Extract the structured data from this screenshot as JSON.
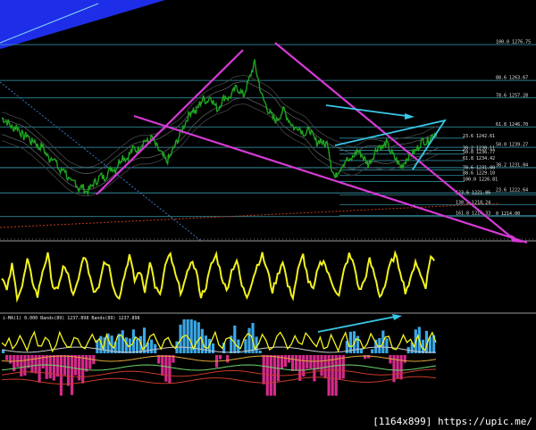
{
  "chart_data": [
    {
      "type": "line",
      "fib_left": {
        "levels": [
          "100.0",
          "88.6",
          "78.6",
          "61.8",
          "50.0",
          "38.2",
          "23.6",
          "0"
        ],
        "prices": [
          "1276.75",
          "1263.67",
          "1257.28",
          "1246.70",
          "1239.27",
          "1231.84",
          "1222.64",
          "1214.00"
        ]
      },
      "fib_mid": {
        "levels": [
          "23.6",
          "38.2",
          "50.0",
          "61.8",
          "78.6",
          "88.6",
          "100.0"
        ],
        "prices": [
          "1242.61",
          "1238.11",
          "1236.77",
          "1234.42",
          "1231.00",
          "1229.10",
          "1226.81"
        ]
      },
      "fib_lower": {
        "levels": [
          "123.6",
          "138.2",
          "161.8"
        ],
        "prices": [
          "1221.86",
          "1218.24",
          "1214.33"
        ]
      },
      "price_series": [
        1250,
        1249,
        1248,
        1246,
        1247,
        1245,
        1243,
        1244,
        1241,
        1242,
        1239,
        1240,
        1237,
        1235,
        1236,
        1233,
        1230,
        1232,
        1228,
        1226,
        1227,
        1224,
        1225,
        1223,
        1224,
        1226,
        1227,
        1229,
        1228,
        1230,
        1232,
        1231,
        1234,
        1236,
        1235,
        1237,
        1239,
        1238,
        1240,
        1242,
        1241,
        1243,
        1240,
        1238,
        1236,
        1234,
        1236,
        1239,
        1242,
        1245,
        1248,
        1251,
        1253,
        1252,
        1255,
        1257,
        1256,
        1258,
        1255,
        1253,
        1256,
        1258,
        1257,
        1259,
        1261,
        1260,
        1258,
        1262,
        1266,
        1270,
        1264,
        1258,
        1255,
        1252,
        1250,
        1249,
        1251,
        1253,
        1250,
        1248,
        1246,
        1247,
        1245,
        1244,
        1246,
        1243,
        1241,
        1242,
        1240,
        1241,
        1232,
        1228,
        1231,
        1233,
        1235,
        1234,
        1236,
        1238,
        1237,
        1235,
        1233,
        1235,
        1238,
        1240,
        1239,
        1241,
        1238,
        1236,
        1234,
        1232,
        1234,
        1236,
        1237,
        1238,
        1240,
        1242,
        1241,
        1243,
        1244,
        1245
      ],
      "oscillator": [
        0.5,
        0.2,
        0.7,
        0.1,
        0.3,
        0.8,
        0.4,
        0.1,
        0.6,
        0.9,
        0.3,
        0.2,
        0.7,
        0.5,
        0.1,
        0.4,
        0.9,
        0.6,
        0.2,
        0.3,
        0.8,
        0.7,
        0.2,
        0.1,
        0.5,
        0.9,
        0.4,
        0.6,
        0.2,
        0.8,
        0.3,
        0.1,
        0.7,
        0.9,
        0.5,
        0.2,
        0.4,
        0.8,
        0.6,
        0.1,
        0.3,
        0.7,
        0.9,
        0.5,
        0.2,
        0.6,
        0.8,
        0.3,
        0.1,
        0.4,
        0.7,
        0.9,
        0.6,
        0.2,
        0.5,
        0.8,
        0.3,
        0.1,
        0.6,
        0.9,
        0.4,
        0.2,
        0.7,
        0.8,
        0.5,
        0.3,
        0.1,
        0.6,
        0.9,
        0.7,
        0.2,
        0.4,
        0.8,
        0.5,
        0.1,
        0.3,
        0.7,
        0.9,
        0.6,
        0.2,
        0.4,
        0.8,
        0.5,
        0.3,
        0.9,
        0.7
      ],
      "indicator_label": "i-MA(1) 0.000  Bands(89) 1237.898  Bands(89) 1237.898",
      "watermark": "[1164x899] https://upic.me/",
      "colors": {
        "price": "#1fa51f",
        "fib": "#3aa0b4",
        "trend": "#d63ad6",
        "wedge": "#39c6e6",
        "osc": "#f2f21e",
        "hist_up": "#3ba7e6",
        "hist_dn": "#d62a8c"
      }
    }
  ]
}
